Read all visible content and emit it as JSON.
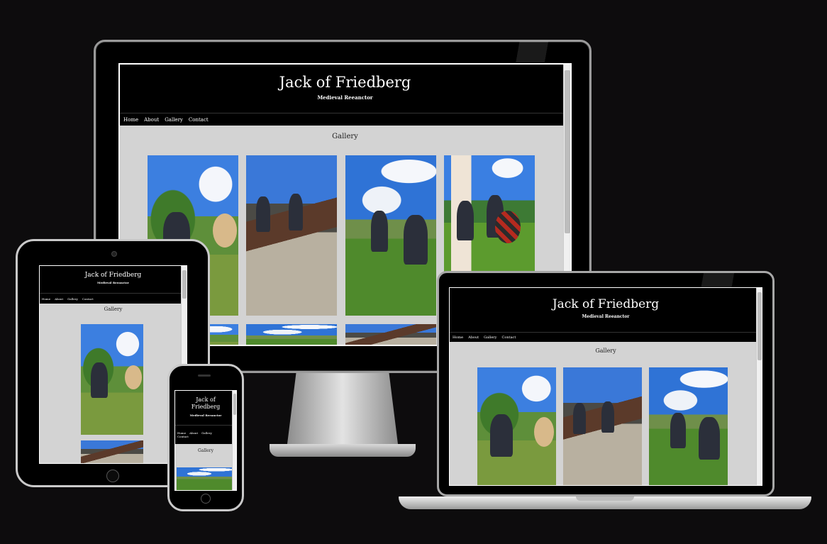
{
  "site": {
    "title": "Jack of Friedberg",
    "title_mobile_line1": "Jack of",
    "title_mobile_line2": "Friedberg",
    "tagline": "Medieval Reeanctor",
    "nav": [
      "Home",
      "About",
      "Gallery",
      "Contact"
    ],
    "section_heading": "Gallery"
  },
  "colors": {
    "page_background": "#0d0c0d",
    "header_background": "#000000",
    "content_background": "#d3d3d3",
    "text_light": "#ffffff"
  },
  "gallery": {
    "photos": [
      {
        "name": "reenactor-with-shield",
        "scene": "scene-a"
      },
      {
        "name": "sword-duel-gravel",
        "scene": "scene-b"
      },
      {
        "name": "sword-fight-crowd",
        "scene": "scene-c"
      },
      {
        "name": "shield-wall-castle",
        "scene": "scene-d"
      }
    ]
  }
}
